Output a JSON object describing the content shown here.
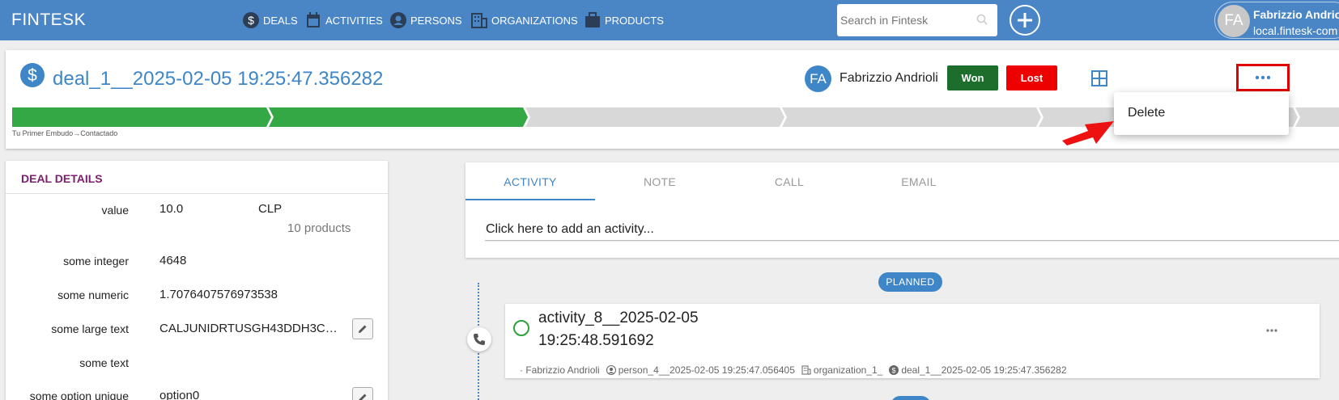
{
  "navbar": {
    "brand": "FINTESK",
    "items": [
      {
        "label": "DEALS",
        "icon": "dollar-circle-icon"
      },
      {
        "label": "ACTIVITIES",
        "icon": "calendar-icon"
      },
      {
        "label": "PERSONS",
        "icon": "person-icon"
      },
      {
        "label": "ORGANIZATIONS",
        "icon": "building-icon"
      },
      {
        "label": "PRODUCTS",
        "icon": "briefcase-icon"
      }
    ],
    "search_placeholder": "Search in Fintesk",
    "user": {
      "initials": "FA",
      "name": "Fabrizzio Andrioli",
      "host": "local.fintesk-com"
    }
  },
  "deal": {
    "title": "deal_1__2025-02-05 19:25:47.356282",
    "owner_initials": "FA",
    "owner_name": "Fabrizzio Andrioli",
    "won_label": "Won",
    "lost_label": "Lost",
    "pipeline_label": "Tu Primer Embudo→Contactado",
    "stages_completed": 2,
    "stages_total": 6,
    "menu_items": [
      "Delete"
    ]
  },
  "details": {
    "header": "DEAL DETAILS",
    "value_label": "value",
    "value": "10.0",
    "currency": "CLP",
    "products": "10 products",
    "fields": [
      {
        "label": "some integer",
        "value": "4648"
      },
      {
        "label": "some numeric",
        "value": "1.7076407576973538"
      },
      {
        "label": "some large text",
        "value": "CALJUNIDRTUSGH43DDH3C…"
      },
      {
        "label": "some text",
        "value": ""
      },
      {
        "label": "some option unique",
        "value": "option0"
      }
    ]
  },
  "activity_panel": {
    "tabs": [
      "ACTIVITY",
      "NOTE",
      "CALL",
      "EMAIL"
    ],
    "active_tab": "ACTIVITY",
    "add_placeholder": "Click here to add an activity...",
    "planned_label": "PLANNED"
  },
  "activity": {
    "title": "activity_8__2025-02-05 19:25:48.591692",
    "owner": "· Fabrizzio Andrioli",
    "person": "person_4__2025-02-05 19:25:47.056405",
    "organization": "organization_1_",
    "deal": "deal_1__2025-02-05 19:25:47.356282"
  },
  "colors": {
    "navbar": "#4a86c6",
    "accent": "#3e86c7",
    "stage_done": "#34a845",
    "stage_todo": "#d8d8d8",
    "won": "#1d6e2d",
    "lost": "#ee0000",
    "details_header": "#7b1f6e"
  }
}
